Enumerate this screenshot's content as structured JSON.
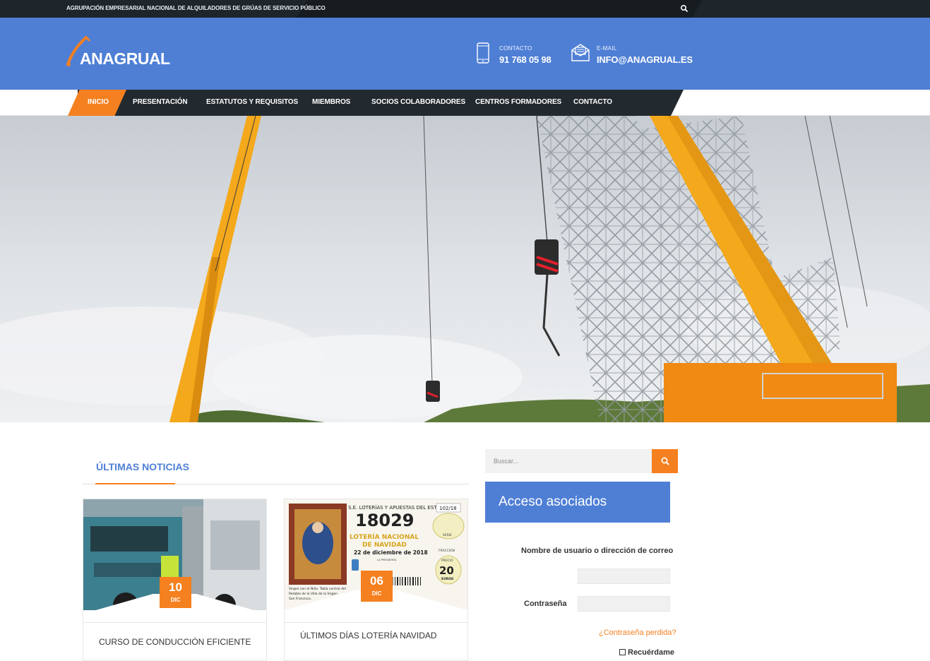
{
  "topbar": {
    "tagline": "AGRUPACIÓN EMPRESARIAL NACIONAL DE ALQUILADORES DE GRÚAS DE SERVICIO PÚBLICO",
    "search_icon": "search-icon"
  },
  "header": {
    "logo_text": "ANAGRUAL",
    "phone": {
      "label": "CONTACTO",
      "value": "91 768 05 98",
      "icon": "smartphone-icon"
    },
    "email": {
      "label": "E-MAIL",
      "value": "INFO@ANAGRUAL.ES",
      "icon": "envelope-icon"
    }
  },
  "nav": {
    "items": [
      {
        "label": "INICIO",
        "active": true
      },
      {
        "label": "PRESENTACIÓN"
      },
      {
        "label": "ESTATUTOS Y REQUISITOS"
      },
      {
        "label": "MIEMBROS"
      },
      {
        "label": "SOCIOS COLABORADORES"
      },
      {
        "label": "CENTROS FORMADORES"
      },
      {
        "label": "CONTACTO"
      }
    ]
  },
  "news": {
    "title": "ÚLTIMAS NOTICIAS",
    "cards": [
      {
        "day": "10",
        "month": "DIC",
        "title": "CURSO DE CONDUCCIÓN EFICIENTE"
      },
      {
        "day": "06",
        "month": "DIC",
        "title": "ÚLTIMOS DÍAS LOTERÍA NAVIDAD",
        "ticket": {
          "header": "S.E. LOTERÍAS Y APUESTAS DEL ESTADO",
          "code": "102/18",
          "number": "18029",
          "name_line1": "LOTERÍA NACIONAL",
          "name_line2": "DE NAVIDAD",
          "date": "22 de diciembre de 2018",
          "serie_label": "SERIE",
          "fraccion_label": "FRACCIÓN",
          "precio_label": "PRECIO",
          "price": "20",
          "currency": "EUROS",
          "signature_label": "LA PRESIDENTA",
          "caption_line1": "Virgen con el Niño. Tabla central del",
          "caption_line2": "Retablo de la Villa de la Virgen",
          "caption_line3": "San Francisco."
        }
      }
    ]
  },
  "sidebar": {
    "search_placeholder": "Buscar...",
    "login": {
      "title": "Acceso asociados",
      "user_label": "Nombre de usuario o dirección de correo",
      "password_label": "Contraseña",
      "lost_password": "¿Contraseña perdida?",
      "remember": "Recuérdame"
    }
  },
  "colors": {
    "brand_blue": "#4f7fd5",
    "accent_orange": "#f5801f",
    "nav_dark": "#232a2f",
    "topbar": "#1f262b"
  }
}
